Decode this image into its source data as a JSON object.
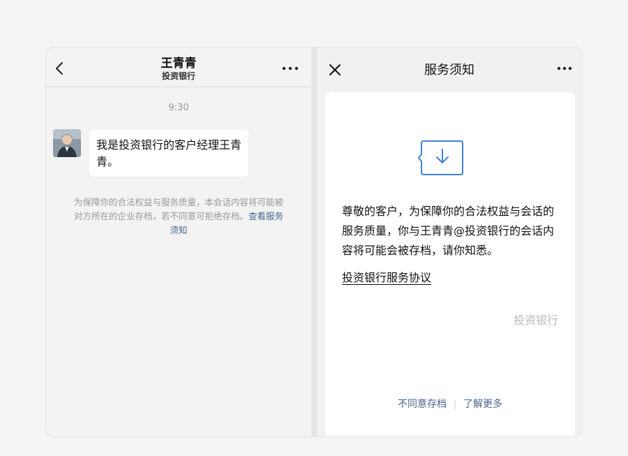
{
  "chat": {
    "title": "王青青",
    "subtitle": "投资银行",
    "time": "9:30",
    "message": "我是投资银行的客户经理王青青。",
    "notice_text": "为保障你的合法权益与服务质量，本会话内容将可能被对方所在的企业存档，若不同意可拒绝存档。",
    "notice_link": "查看服务须知"
  },
  "service_notice": {
    "title": "服务须知",
    "body": "尊敬的客户，为保障你的合法权益与会话的服务质量，你与王青青@投资银行的会话内容将可能会被存档，请你知悉。",
    "agreement_link": "投资银行服务协议",
    "signature": "投资银行",
    "decline_button": "不同意存档",
    "separator": "|",
    "learn_more_button": "了解更多"
  },
  "icons": {
    "back": "chevron-left-icon",
    "more": "more-dots-icon",
    "close": "close-icon",
    "archive": "archive-download-icon"
  },
  "colors": {
    "link": "#4a6790",
    "accent": "#3b82d6",
    "muted_text": "#999999"
  }
}
